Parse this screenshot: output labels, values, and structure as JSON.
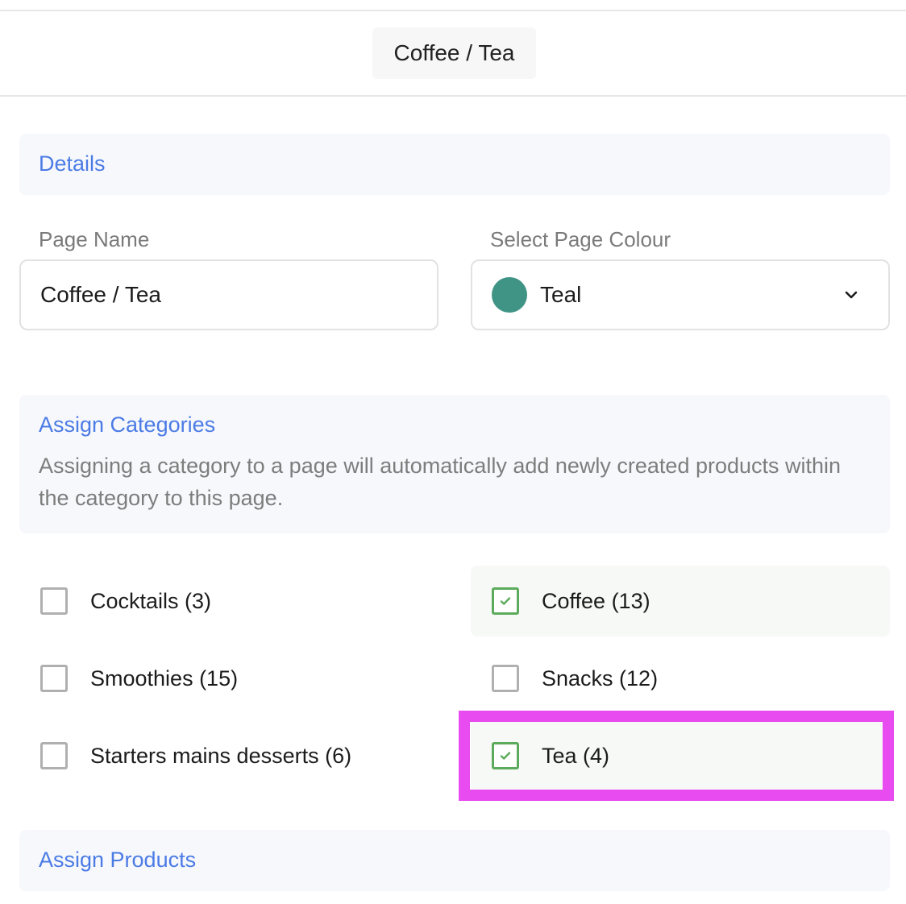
{
  "header": {
    "title": "Coffee / Tea"
  },
  "details": {
    "title": "Details",
    "page_name_label": "Page Name",
    "page_name_value": "Coffee / Tea",
    "colour_label": "Select Page Colour",
    "colour_value": "Teal",
    "colour_hex": "#409486"
  },
  "categories": {
    "title": "Assign Categories",
    "description": "Assigning a category to a page will automatically add newly created products within the category to this page.",
    "items": [
      {
        "label": "Cocktails (3)",
        "checked": false
      },
      {
        "label": "Coffee (13)",
        "checked": true
      },
      {
        "label": "Smoothies (15)",
        "checked": false
      },
      {
        "label": "Snacks (12)",
        "checked": false
      },
      {
        "label": "Starters mains desserts (6)",
        "checked": false
      },
      {
        "label": "Tea (4)",
        "checked": true
      }
    ]
  },
  "products": {
    "title": "Assign Products"
  },
  "colors": {
    "accent": "#4b7be5",
    "checked_green": "#5cab5c",
    "highlight": "#e84cf0"
  }
}
